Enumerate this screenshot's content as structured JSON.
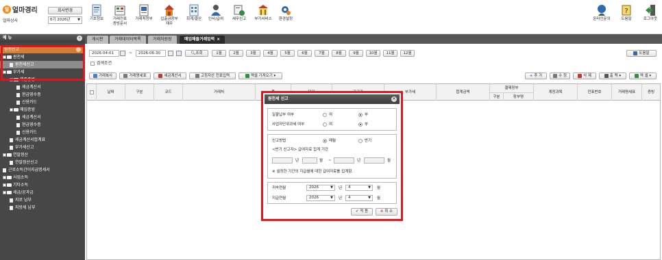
{
  "app": {
    "logo_mark": "얼",
    "name": "얼마경리",
    "company": "얼마상사",
    "company_change_label": "회사변경",
    "period_value": "6기 2026년"
  },
  "toolbar": {
    "items": [
      {
        "label": "기초정보",
        "icon": "basic-info-icon"
      },
      {
        "label": "거래전표\n증빙문서",
        "icon": "voucher-icon"
      },
      {
        "label": "거래처정부",
        "icon": "client-icon"
      },
      {
        "label": "입출금장부\n재무",
        "icon": "cashbook-icon"
      },
      {
        "label": "회계/결산",
        "icon": "accounting-icon"
      },
      {
        "label": "인사/급여",
        "icon": "payroll-icon"
      },
      {
        "label": "세무신고",
        "icon": "tax-icon"
      },
      {
        "label": "부가서비스",
        "icon": "service-icon"
      },
      {
        "label": "환경설정",
        "icon": "settings-icon"
      }
    ],
    "right_items": [
      {
        "label": "온라인문의",
        "icon": "inquiry-icon"
      },
      {
        "label": "도움말",
        "icon": "help-icon"
      },
      {
        "label": "로그아웃",
        "icon": "logout-icon"
      }
    ]
  },
  "sidebar": {
    "title": "메 뉴",
    "section": "원천신고",
    "items": [
      {
        "label": "원천세",
        "level": 0,
        "kind": "folder"
      },
      {
        "label": "원천세신고",
        "level": 1,
        "kind": "doc",
        "selected": true
      },
      {
        "label": "부가세",
        "level": 0,
        "kind": "folder"
      },
      {
        "label": "매출증빙",
        "level": 1,
        "kind": "folder"
      },
      {
        "label": "세금계산서",
        "level": 2,
        "kind": "doc"
      },
      {
        "label": "현금영수증",
        "level": 2,
        "kind": "doc"
      },
      {
        "label": "신용카드",
        "level": 2,
        "kind": "doc"
      },
      {
        "label": "매입증빙",
        "level": 1,
        "kind": "folder"
      },
      {
        "label": "세금계산서",
        "level": 2,
        "kind": "doc"
      },
      {
        "label": "현금영수증",
        "level": 2,
        "kind": "doc"
      },
      {
        "label": "신용카드",
        "level": 2,
        "kind": "doc"
      },
      {
        "label": "세금계산서합계표",
        "level": 1,
        "kind": "doc"
      },
      {
        "label": "부가세신고",
        "level": 1,
        "kind": "doc"
      },
      {
        "label": "연말정산",
        "level": 0,
        "kind": "folder"
      },
      {
        "label": "연말정산신고",
        "level": 1,
        "kind": "doc"
      },
      {
        "label": "근로소득간이지급명세서",
        "level": 0,
        "kind": "doc"
      },
      {
        "label": "사업소득",
        "level": 0,
        "kind": "folder"
      },
      {
        "label": "기타소득",
        "level": 0,
        "kind": "folder"
      },
      {
        "label": "세금/공과금",
        "level": 0,
        "kind": "folder"
      },
      {
        "label": "지로 납부",
        "level": 1,
        "kind": "doc"
      },
      {
        "label": "지방세 납부",
        "level": 1,
        "kind": "doc"
      }
    ]
  },
  "tabs": [
    {
      "label": "게시판",
      "active": false
    },
    {
      "label": "거래데이터목록",
      "active": false
    },
    {
      "label": "거래처원장",
      "active": false
    },
    {
      "label": "매입매출거래입력",
      "active": true,
      "close": "×"
    }
  ],
  "filter": {
    "date_from": "2026-04-01",
    "date_sep": "~",
    "date_to": "2026-06-30",
    "search_label": "조회",
    "months": [
      "1월",
      "2월",
      "3월",
      "4월",
      "5월",
      "6월",
      "7월",
      "8월",
      "9월",
      "10월",
      "11월",
      "12월"
    ],
    "condition_label": "검색조건",
    "help_label": "도움말"
  },
  "actions": {
    "left": [
      "거래복사",
      "거래명세표",
      "세금계산서",
      "고정자산 전표입력",
      "엑셀 가져오기"
    ],
    "right": [
      "추 가",
      "수 정",
      "삭 제",
      "출 력",
      "엑 셀"
    ]
  },
  "grid": {
    "headers": [
      "날짜",
      "구분",
      "코드",
      "거래처",
      "품",
      "단가",
      "공급가",
      "부가세",
      "합계금액",
      "결제장부",
      "계정과목",
      "전표번호",
      "거래명세표",
      "증빙"
    ],
    "sub_headers": [
      "구분",
      "장부명"
    ]
  },
  "modal": {
    "title": "원천세 신고",
    "close": "✕",
    "monthly_label": "일괄납부 여부",
    "unit_label": "사업자단위과세 여부",
    "yes": "여",
    "no": "부",
    "method_label": "신고방법",
    "monthly_opt": "매월",
    "half_opt": "반기",
    "half_note": "<반기 신고자> 급여자료 집계 기간",
    "year": "년",
    "month": "월",
    "tilde": "~",
    "set_note": "※ 설정한 기간의 지급월에 대한 급여자료를 집계함.",
    "belong_label": "귀속연월",
    "pay_label": "지급연월",
    "belong_year": "2026",
    "belong_month": "4",
    "pay_year": "2026",
    "pay_month": "4",
    "ok": "적 용",
    "cancel": "취 소"
  }
}
